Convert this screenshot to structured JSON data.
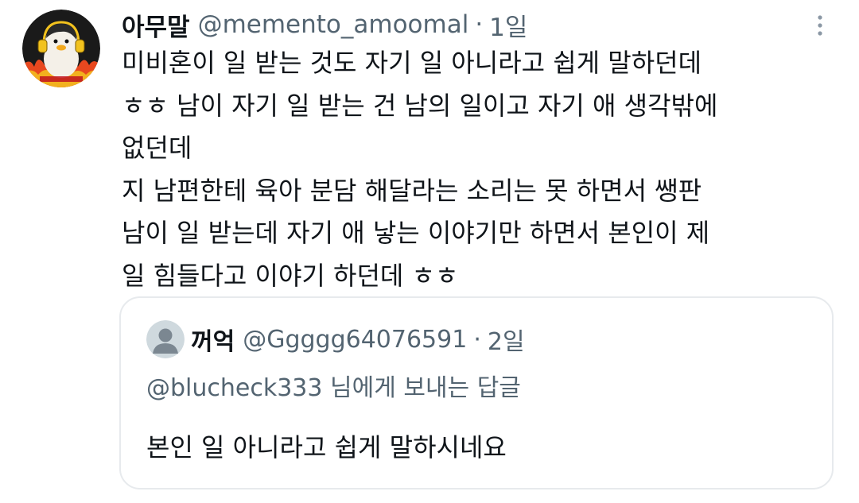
{
  "tweet": {
    "display_name": "아무말",
    "handle": "@memento_amoomal",
    "separator": "·",
    "time": "1일",
    "avatar_icon": "penguin-headphones-avatar-icon",
    "more_icon": "more-vertical-icon",
    "lines": [
      "미비혼이 일 받는 것도 자기 일 아니라고 쉽게 말하던데",
      "ㅎㅎ 남이 자기 일 받는 건 남의 일이고 자기 애 생각밖에",
      "없던데",
      "지 남편한테 육아 분담 해달라는 소리는 못 하면서 쌩판",
      "남이 일 받는데 자기 애 낳는 이야기만 하면서 본인이 제",
      "일 힘들다고 이야기 하던데 ㅎㅎ"
    ]
  },
  "quote": {
    "display_name": "꺼억",
    "handle": "@Ggggg64076591",
    "separator": "·",
    "time": "2일",
    "avatar_icon": "default-profile-icon",
    "reply_mention": "@blucheck333",
    "reply_suffix": " 님에게 보내는 답글",
    "text": "본인 일 아니라고 쉽게 말하시네요"
  },
  "colors": {
    "text_primary": "#0f1419",
    "text_secondary": "#536471",
    "border": "#e7eaed"
  }
}
